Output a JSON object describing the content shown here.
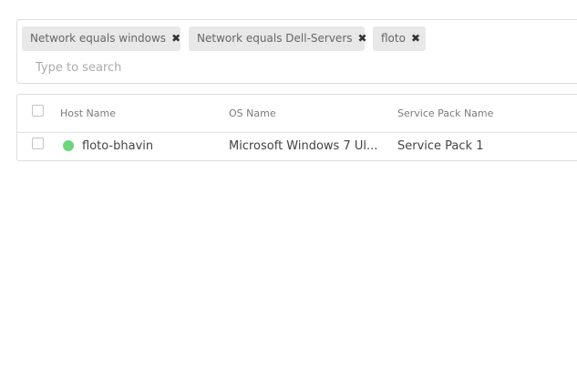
{
  "filters": {
    "chips": [
      {
        "label": "Network equals windows",
        "remove": "✖"
      },
      {
        "label": "Network equals Dell-Servers",
        "remove": "✖"
      },
      {
        "label": "floto",
        "remove": "✖"
      }
    ],
    "search_placeholder": "Type to search"
  },
  "table": {
    "columns": [
      "Host Name",
      "OS Name",
      "Service Pack Name"
    ],
    "rows": [
      {
        "host_name": "floto-bhavin",
        "os_name": "Microsoft Windows 7 Ul...",
        "service_pack": "Service Pack 1",
        "status_color": "#6cd67a"
      }
    ]
  }
}
